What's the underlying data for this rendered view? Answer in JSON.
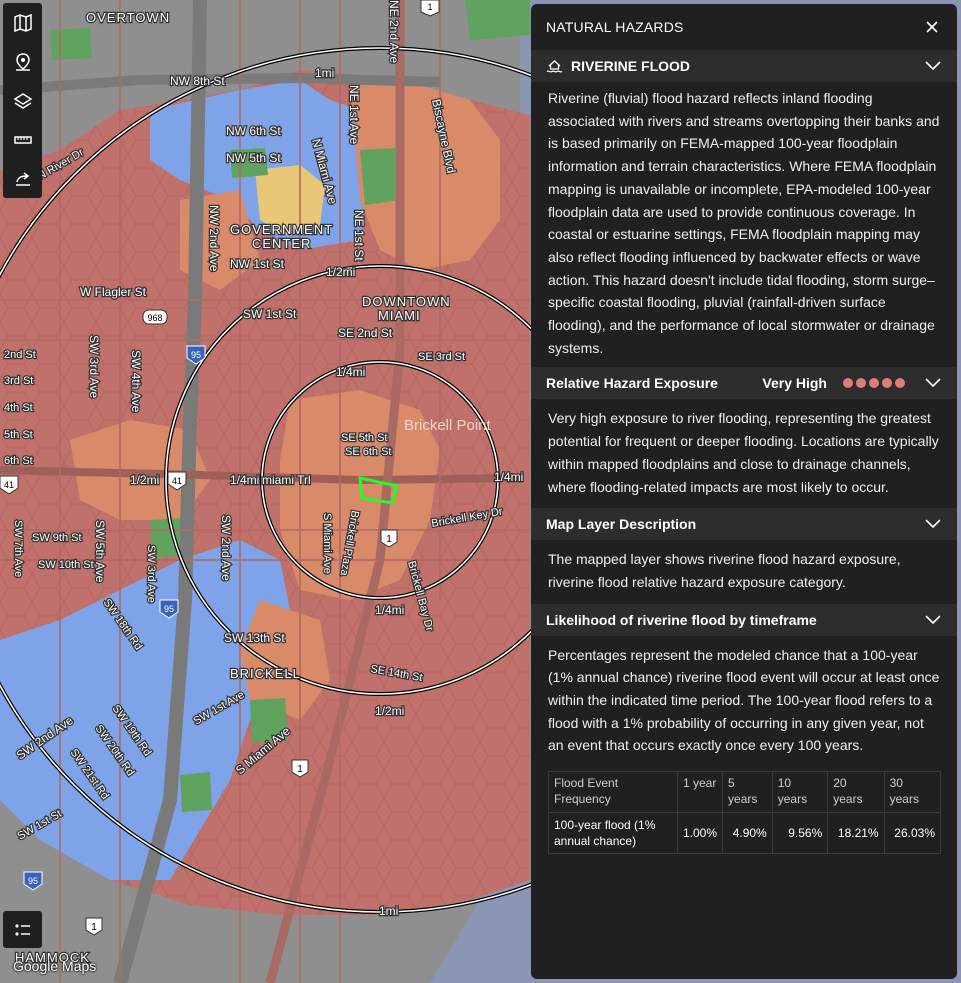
{
  "map": {
    "neighborhoods": [
      "OVERTOWN",
      "GOVERNMENT",
      "CENTER",
      "DOWNTOWN",
      "MIAMI",
      "BRICKELL",
      "HAMMOCK",
      "Brickell Point"
    ],
    "streets": [
      "NW 8th St",
      "NW 6th St",
      "NW 5th St",
      "N Miami Ave",
      "NE 1st Ave",
      "NE 2nd Ave",
      "NE 1st St",
      "NW 1st St",
      "NW 2nd Ave",
      "Biscayne Blvd",
      "W Flagler St",
      "SW 1st St",
      "SE 2nd St",
      "SE 3rd St",
      "SW 3rd Ave",
      "SW 4th Ave",
      "SE 5th St",
      "SE 6th St",
      "Brickell Key Dr",
      "SW 9th St",
      "SW 10th St",
      "SW 5th Ave",
      "SW 2nd Ave",
      "S Miami Ave",
      "Brickell Plaza",
      "Brickell Bay Dr",
      "SW 13th St",
      "SE 14th St",
      "SW 1st Ave",
      "SW 20th Rd",
      "SW 19th Rd",
      "SW 21st Rd",
      "SW 2nd Ave",
      "SW 1st St",
      "SW 7th Ave",
      "S Miami Ave",
      "SW 18th Rd",
      "SW 3rd Ave",
      "2nd St",
      "3rd St",
      "4th St",
      "5th St",
      "6th St",
      "N River Dr"
    ],
    "road_shields": [
      "968",
      "95",
      "41",
      "1",
      "95",
      "1",
      "1",
      "95",
      "41",
      "1"
    ],
    "ring_labels": [
      "1mi",
      "1/2mi",
      "1/4mi",
      "1/4mi",
      "1/2mi",
      "1/4mi",
      "1/4mi",
      "1/2mi",
      "1mi",
      "1/2mi"
    ],
    "road_name_center": "miami Trl",
    "attribution": "Google Maps"
  },
  "toolbar": {
    "tools": [
      "map-icon",
      "pin-icon",
      "layers-icon",
      "ruler-icon",
      "share-icon"
    ],
    "legend_icon": "legend-icon"
  },
  "panel": {
    "title": "NATURAL HAZARDS",
    "hazard": {
      "name": "RIVERINE FLOOD",
      "description": "Riverine (fluvial) flood hazard reflects inland flooding associated with rivers and streams overtopping their banks and is based primarily on FEMA-mapped 100-year floodplain information and terrain characteristics. Where FEMA floodplain mapping is unavailable or incomplete, EPA-modeled 100-year floodplain data are used to provide continuous coverage. In coastal or estuarine settings, FEMA floodplain mapping may also reflect flooding influenced by backwater effects or wave action. This hazard doesn't include tidal flooding, storm surge–specific coastal flooding, pluvial (rainfall-driven surface flooding), and the performance of local stormwater or drainage systems."
    },
    "exposure": {
      "label": "Relative Hazard Exposure",
      "level": "Very High",
      "dots_filled": 5,
      "dot_color": "#e07c7c",
      "description": "Very high exposure to river flooding, representing the greatest potential for frequent or deeper flooding. Locations are typically within mapped floodplains and close to drainage channels, where flooding-related impacts are most likely to occur."
    },
    "layer": {
      "label": "Map Layer Description",
      "description": "The mapped layer shows riverine flood hazard exposure, riverine flood relative hazard exposure category."
    },
    "likelihood": {
      "label": "Likelihood of riverine flood by timeframe",
      "description": "Percentages represent the modeled chance that a 100-year (1% annual chance) riverine flood event will occur at least once within the indicated time period. The 100-year flood refers to a flood with a 1% probability of occurring in any given year, not an event that occurs exactly once every 100 years.",
      "table": {
        "headers": [
          "Flood Event Frequency",
          "1 year",
          "5 years",
          "10 years",
          "20 years",
          "30 years"
        ],
        "row": [
          "100-year flood (1% annual chance)",
          "1.00%",
          "4.90%",
          "9.56%",
          "18.21%",
          "26.03%"
        ]
      }
    }
  },
  "colors": {
    "very_high": "#c0716b",
    "high": "#d98a68",
    "moderate": "#e8c878",
    "low": "#7fa3e8",
    "park": "#5fa35f",
    "water": "#8a96b4",
    "selection": "#22ff22"
  }
}
